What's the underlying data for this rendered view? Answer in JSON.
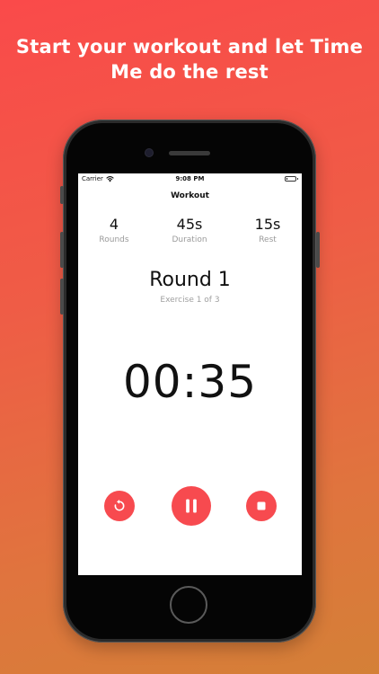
{
  "headline": "Start your workout and let Time Me do the rest",
  "status_bar": {
    "carrier": "Carrier",
    "time": "9:08 PM",
    "battery_level": 0.15
  },
  "nav": {
    "title": "Workout"
  },
  "stats": [
    {
      "value": "4",
      "label": "Rounds"
    },
    {
      "value": "45s",
      "label": "Duration"
    },
    {
      "value": "15s",
      "label": "Rest"
    }
  ],
  "round": {
    "title": "Round 1",
    "subtitle": "Exercise 1 of 3"
  },
  "timer": "00:35",
  "controls": {
    "restart_icon": "restart-icon",
    "pause_icon": "pause-icon",
    "stop_icon": "stop-icon"
  },
  "colors": {
    "accent": "#f74a4f",
    "background_top": "#fa4a4a",
    "background_bottom": "#d48037",
    "text_primary": "#111111",
    "text_secondary": "#9a9a9a"
  }
}
